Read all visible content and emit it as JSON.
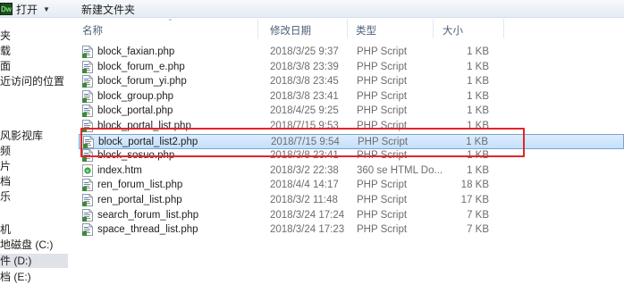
{
  "toolbar": {
    "open_label": "打开",
    "dw_badge": "Dw",
    "new_folder_label": "新建文件夹"
  },
  "nav": [
    {
      "label": "夹"
    },
    {
      "label": "载"
    },
    {
      "label": "面"
    },
    {
      "label": "近访问的位置"
    },
    {
      "label": "风影视库"
    },
    {
      "label": "频"
    },
    {
      "label": "片"
    },
    {
      "label": "档"
    },
    {
      "label": "乐"
    },
    {
      "label": "机"
    },
    {
      "label": "地磁盘 (C:)"
    },
    {
      "label": "件 (D:)",
      "selected": true
    },
    {
      "label": "档 (E:)"
    }
  ],
  "columns": {
    "name": "名称",
    "date": "修改日期",
    "type": "类型",
    "size": "大小"
  },
  "files": [
    {
      "name": "block_faxian.php",
      "date": "2018/3/25 9:37",
      "type": "PHP Script",
      "size": "1 KB",
      "icon": "php-file-icon"
    },
    {
      "name": "block_forum_e.php",
      "date": "2018/3/8 23:39",
      "type": "PHP Script",
      "size": "1 KB",
      "icon": "php-file-icon"
    },
    {
      "name": "block_forum_yi.php",
      "date": "2018/3/8 23:45",
      "type": "PHP Script",
      "size": "1 KB",
      "icon": "php-file-icon"
    },
    {
      "name": "block_group.php",
      "date": "2018/3/8 23:41",
      "type": "PHP Script",
      "size": "1 KB",
      "icon": "php-file-icon"
    },
    {
      "name": "block_portal.php",
      "date": "2018/4/25 9:25",
      "type": "PHP Script",
      "size": "1 KB",
      "icon": "php-file-icon"
    },
    {
      "name": "block_portal_list.php",
      "date": "2018/7/15 9:53",
      "type": "PHP Script",
      "size": "1 KB",
      "icon": "php-file-icon"
    },
    {
      "name": "block_portal_list2.php",
      "date": "2018/7/15 9:54",
      "type": "PHP Script",
      "size": "1 KB",
      "icon": "php-file-icon",
      "selected": true
    },
    {
      "name": "block_sosuo.php",
      "date": "2018/3/8 23:41",
      "type": "PHP Script",
      "size": "1 KB",
      "icon": "php-file-icon"
    },
    {
      "name": "index.htm",
      "date": "2018/3/2 22:38",
      "type": "360 se HTML Do...",
      "size": "1 KB",
      "icon": "html-file-icon"
    },
    {
      "name": "ren_forum_list.php",
      "date": "2018/4/4 14:17",
      "type": "PHP Script",
      "size": "18 KB",
      "icon": "php-file-icon"
    },
    {
      "name": "ren_portal_list.php",
      "date": "2018/3/2 11:48",
      "type": "PHP Script",
      "size": "17 KB",
      "icon": "php-file-icon"
    },
    {
      "name": "search_forum_list.php",
      "date": "2018/3/24 17:24",
      "type": "PHP Script",
      "size": "7 KB",
      "icon": "php-file-icon"
    },
    {
      "name": "space_thread_list.php",
      "date": "2018/3/24 17:23",
      "type": "PHP Script",
      "size": "7 KB",
      "icon": "php-file-icon"
    }
  ],
  "colors": {
    "highlight_box": "#e0262a",
    "selection": "#c4e0fc",
    "header_text": "#4c607a"
  }
}
